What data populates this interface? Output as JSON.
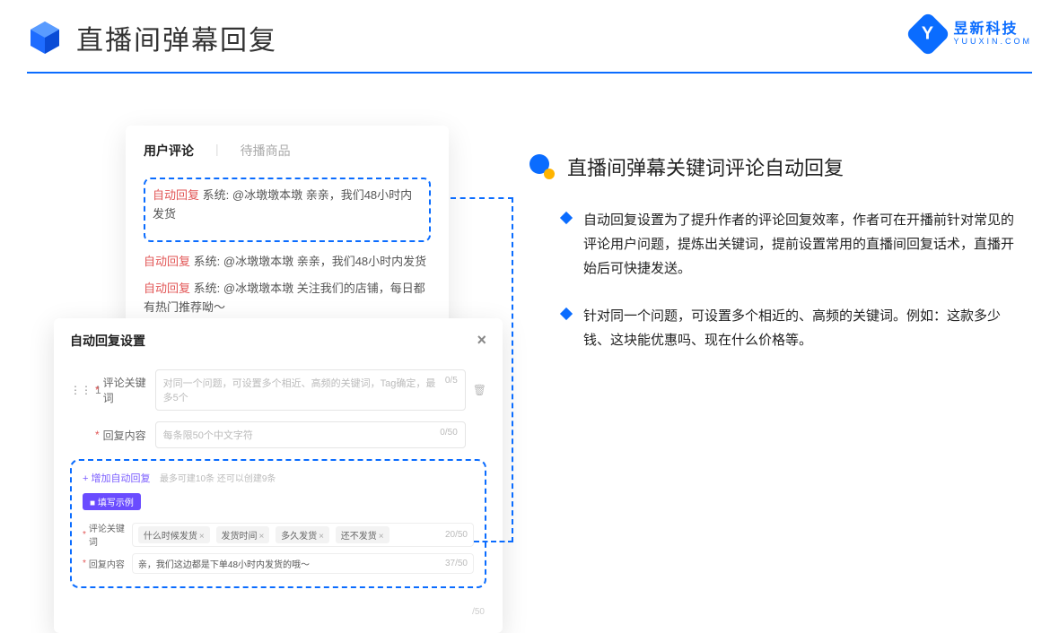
{
  "header": {
    "title": "直播间弹幕回复"
  },
  "brand": {
    "cn": "昱新科技",
    "en": "YUUXIN.COM",
    "letter": "Y"
  },
  "card1": {
    "tab_active": "用户评论",
    "tab_inactive": "待播商品",
    "auto_label": "自动回复",
    "sys_label": "系统:",
    "r1": "@冰墩墩本墩 亲亲，我们48小时内发货",
    "r2": "@冰墩墩本墩 亲亲，我们48小时内发货",
    "r3": "@冰墩墩本墩 关注我们的店铺，每日都有热门推荐呦～"
  },
  "card2": {
    "title": "自动回复设置",
    "num": "1",
    "label_keyword": "评论关键词",
    "ph_keyword": "对同一个问题，可设置多个相近、高频的关键词，Tag确定，最多5个",
    "count_keyword": "0/5",
    "label_content": "回复内容",
    "ph_content": "每条限50个中文字符",
    "count_content": "0/50",
    "add_text": "+ 增加自动回复",
    "add_hint": "最多可建10条 还可以创建9条",
    "example_tag": "■ 填写示例",
    "ex_kw_label": "评论关键词",
    "chips": [
      "什么时候发货",
      "发货时间",
      "多久发货",
      "还不发货"
    ],
    "ex_kw_count": "20/50",
    "ex_ct_label": "回复内容",
    "ex_ct_value": "亲，我们这边都是下单48小时内发货的哦～",
    "ex_ct_count": "37/50",
    "ghost": "/50"
  },
  "right": {
    "section_title": "直播间弹幕关键词评论自动回复",
    "b1": "自动回复设置为了提升作者的评论回复效率，作者可在开播前针对常见的评论用户问题，提炼出关键词，提前设置常用的直播间回复话术，直播开始后可快捷发送。",
    "b2": "针对同一个问题，可设置多个相近的、高频的关键词。例如：这款多少钱、这块能优惠吗、现在什么价格等。"
  }
}
